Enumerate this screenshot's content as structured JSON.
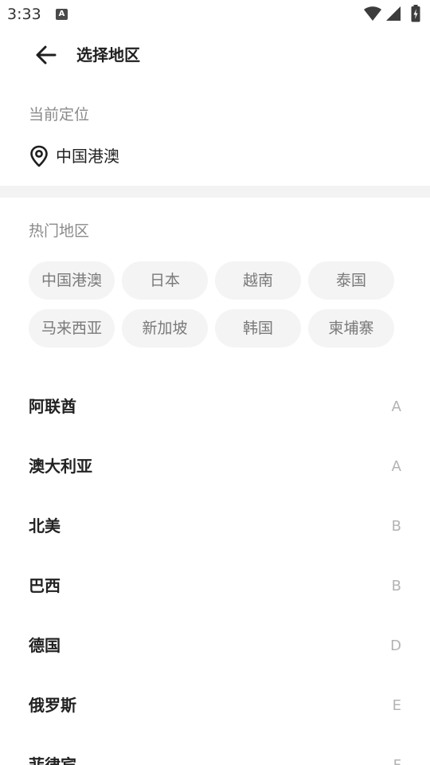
{
  "status_bar": {
    "time": "3:33",
    "notification_icon": "a-icon",
    "notification_glyph": "A",
    "right_icons": [
      "wifi-icon",
      "cellular-signal-icon",
      "battery-charging-icon"
    ]
  },
  "header": {
    "back_icon": "arrow-left-icon",
    "title": "选择地区"
  },
  "current_location": {
    "label": "当前定位",
    "icon": "location-pin-icon",
    "value": "中国港澳"
  },
  "hot_regions": {
    "label": "热门地区",
    "items": [
      "中国港澳",
      "日本",
      "越南",
      "泰国",
      "马来西亚",
      "新加坡",
      "韩国",
      "柬埔寨"
    ]
  },
  "region_list": [
    {
      "name": "阿联酋",
      "letter": "A"
    },
    {
      "name": "澳大利亚",
      "letter": "A"
    },
    {
      "name": "北美",
      "letter": "B"
    },
    {
      "name": "巴西",
      "letter": "B"
    },
    {
      "name": "德国",
      "letter": "D"
    },
    {
      "name": "俄罗斯",
      "letter": "E"
    },
    {
      "name": "菲律宾",
      "letter": "F"
    }
  ],
  "colors": {
    "text_primary": "#222222",
    "text_secondary": "#8a8a8a",
    "chip_background": "#f4f4f4",
    "index_letter": "#b3b3b3",
    "divider": "#f3f3f3"
  }
}
